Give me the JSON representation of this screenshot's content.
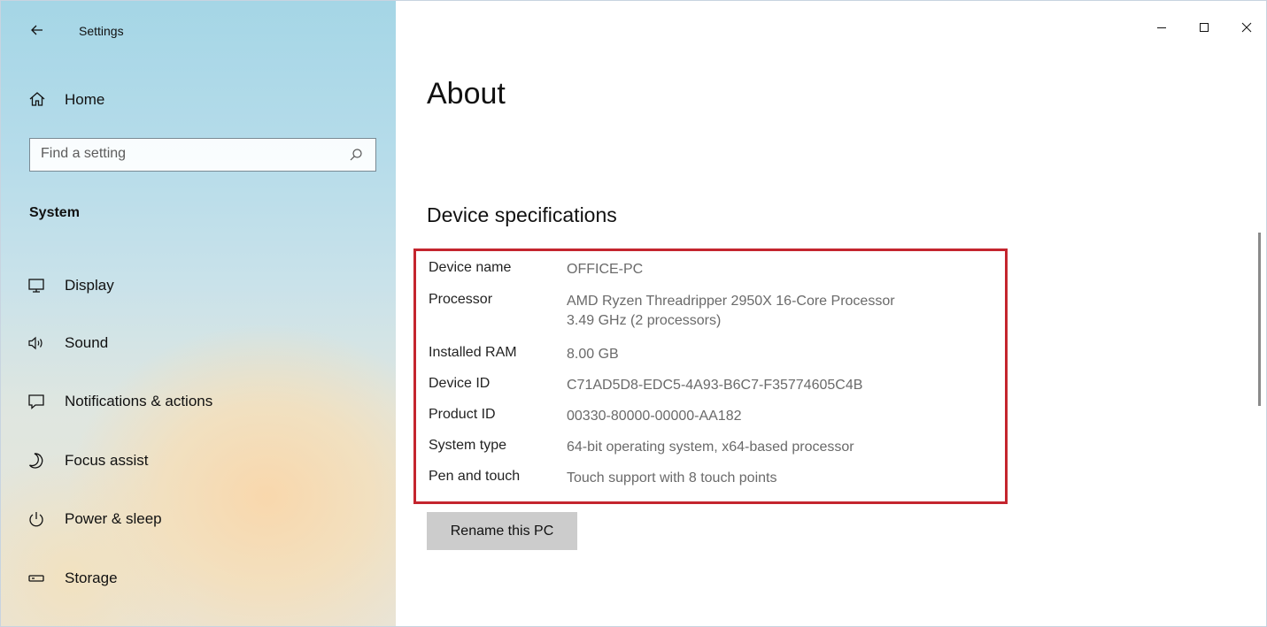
{
  "app": {
    "title": "Settings"
  },
  "sidebar": {
    "home_label": "Home",
    "search_placeholder": "Find a setting",
    "section_label": "System",
    "items": [
      {
        "label": "Display",
        "icon": "monitor-icon"
      },
      {
        "label": "Sound",
        "icon": "speaker-icon"
      },
      {
        "label": "Notifications & actions",
        "icon": "notification-icon"
      },
      {
        "label": "Focus assist",
        "icon": "moon-icon"
      },
      {
        "label": "Power & sleep",
        "icon": "power-icon"
      },
      {
        "label": "Storage",
        "icon": "storage-icon"
      }
    ]
  },
  "main": {
    "page_title": "About",
    "section_title": "Device specifications",
    "specs": [
      {
        "key": "Device name",
        "value": "OFFICE-PC"
      },
      {
        "key": "Processor",
        "value": "AMD Ryzen Threadripper 2950X 16-Core Processor",
        "value2": "3.49 GHz  (2 processors)"
      },
      {
        "key": "Installed RAM",
        "value": "8.00 GB"
      },
      {
        "key": "Device ID",
        "value": "C71AD5D8-EDC5-4A93-B6C7-F35774605C4B"
      },
      {
        "key": "Product ID",
        "value": "00330-80000-00000-AA182"
      },
      {
        "key": "System type",
        "value": "64-bit operating system, x64-based processor"
      },
      {
        "key": "Pen and touch",
        "value": "Touch support with 8 touch points"
      }
    ],
    "rename_button": "Rename this PC"
  },
  "colors": {
    "highlight_border": "#c4252e",
    "button_bg": "#cccccc"
  }
}
